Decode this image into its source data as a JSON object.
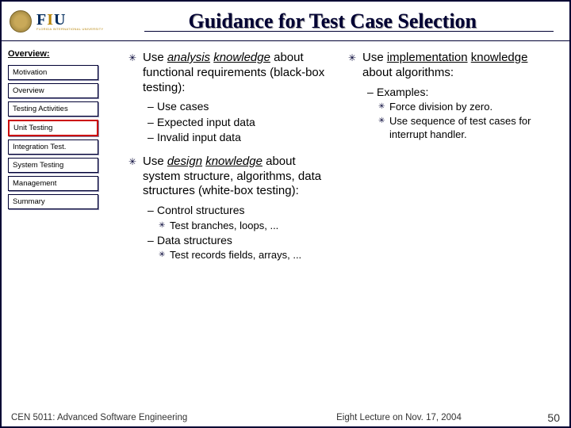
{
  "header": {
    "logo_main": "FIU",
    "logo_sub": "FLORIDA INTERNATIONAL UNIVERSITY",
    "title": "Guidance for Test Case Selection"
  },
  "sidebar": {
    "label": "Overview:",
    "items": [
      {
        "label": "Motivation",
        "active": false
      },
      {
        "label": "Overview",
        "active": false
      },
      {
        "label": "Testing Activities",
        "active": false
      },
      {
        "label": "Unit Testing",
        "active": true
      },
      {
        "label": "Integration Test.",
        "active": false
      },
      {
        "label": "System Testing",
        "active": false
      },
      {
        "label": "Management",
        "active": false
      },
      {
        "label": "Summary",
        "active": false
      }
    ]
  },
  "content": {
    "left": {
      "b1_pre": "Use ",
      "b1_u1": "analysis",
      "b1_mid1": "  ",
      "b1_u2": "knowledge",
      "b1_post": " about functional requirements (black-box testing):",
      "b1_subs": [
        "Use cases",
        "Expected input data",
        "Invalid input data"
      ],
      "b2_pre": "Use ",
      "b2_u1": "design",
      "b2_mid1": "  ",
      "b2_u2": "knowledge",
      "b2_post": " about system structure, algorithms, data structures  (white-box testing):",
      "b2_sub1": "Control structures",
      "b2_sub1_s": "Test branches, loops, ...",
      "b2_sub2": "Data structures",
      "b2_sub2_s": "Test records fields, arrays, ..."
    },
    "right": {
      "b1_pre": "Use ",
      "b1_u1": "implementation",
      "b1_u2": "knowledge",
      "b1_post": " about algorithms:",
      "b1_sub1": "Examples:",
      "b1_sub1_s": [
        "Force division by zero.",
        "Use sequence of test cases for interrupt handler."
      ]
    }
  },
  "footer": {
    "left": "CEN 5011: Advanced Software Engineering",
    "mid": "Eight Lecture on Nov. 17, 2004",
    "right": "50"
  }
}
